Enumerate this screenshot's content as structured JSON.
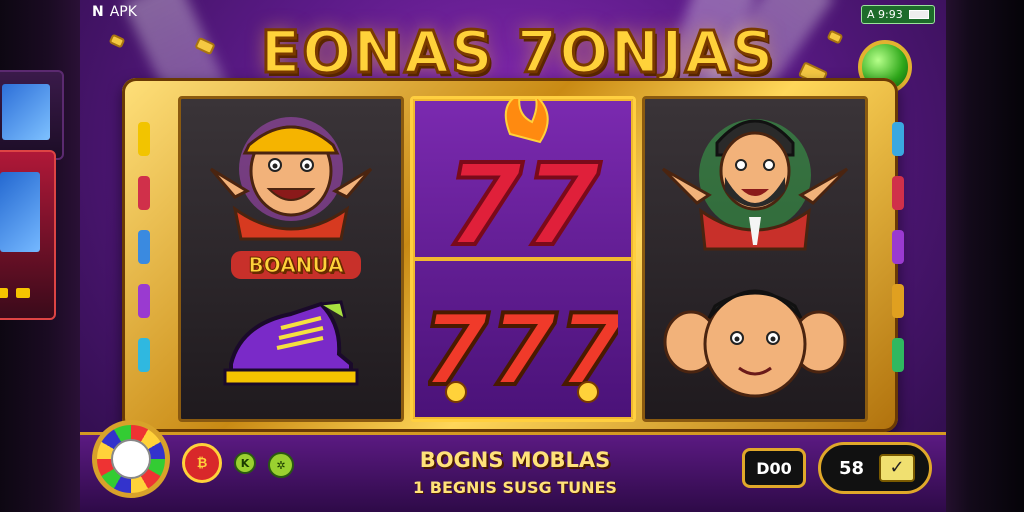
{
  "status_bar": {
    "left_label": "APK",
    "right_label": "A 9:93"
  },
  "title": "EONAS 7ONJAS",
  "reels": {
    "left": {
      "top_symbol": "character-with-cap",
      "badge_text": "BOANUA",
      "bottom_symbol": "sneaker"
    },
    "middle": {
      "top_symbol": "seven-seven",
      "top_text": "77",
      "bottom_symbol": "triple-seven",
      "bottom_text": "777"
    },
    "right": {
      "top_symbol": "bearded-character",
      "bottom_symbol": "big-eared-character"
    }
  },
  "bottom_bar": {
    "headline": "BOGNS MOBLAS",
    "subline": "1 BEGNIS SUSG TUNES",
    "credit_value": "D00",
    "bet_value": "58"
  },
  "colors": {
    "gold": "#ffd23a",
    "purple": "#5a1a86",
    "frame": "#c98a14"
  }
}
